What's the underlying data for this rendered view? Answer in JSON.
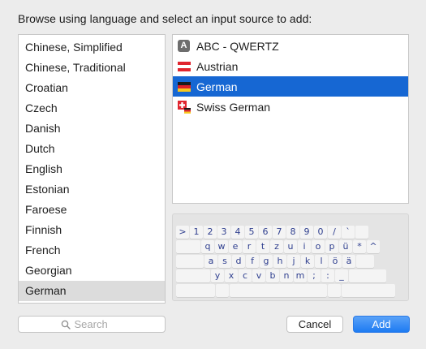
{
  "header": {
    "title": "Browse using language and select an input source to add:"
  },
  "languages": [
    {
      "label": "Chinese, Simplified",
      "selected": false
    },
    {
      "label": "Chinese, Traditional",
      "selected": false
    },
    {
      "label": "Croatian",
      "selected": false
    },
    {
      "label": "Czech",
      "selected": false
    },
    {
      "label": "Danish",
      "selected": false
    },
    {
      "label": "Dutch",
      "selected": false
    },
    {
      "label": "English",
      "selected": false
    },
    {
      "label": "Estonian",
      "selected": false
    },
    {
      "label": "Faroese",
      "selected": false
    },
    {
      "label": "Finnish",
      "selected": false
    },
    {
      "label": "French",
      "selected": false
    },
    {
      "label": "Georgian",
      "selected": false
    },
    {
      "label": "German",
      "selected": true
    }
  ],
  "sources": [
    {
      "label": "ABC - QWERTZ",
      "icon": "abc-icon",
      "icon_text": "A",
      "selected": false
    },
    {
      "label": "Austrian",
      "icon": "austria-flag-icon",
      "selected": false
    },
    {
      "label": "German",
      "icon": "germany-flag-icon",
      "selected": true
    },
    {
      "label": "Swiss German",
      "icon": "switzerland-flag-icon",
      "selected": false
    }
  ],
  "keyboard": {
    "rows": [
      [
        ">",
        "1",
        "2",
        "3",
        "4",
        "5",
        "6",
        "7",
        "8",
        "9",
        "0",
        "/",
        "`",
        ""
      ],
      [
        "",
        "q",
        "w",
        "e",
        "r",
        "t",
        "z",
        "u",
        "i",
        "o",
        "p",
        "ü",
        "*",
        "^"
      ],
      [
        "",
        "a",
        "s",
        "d",
        "f",
        "g",
        "h",
        "j",
        "k",
        "l",
        "ö",
        "ä",
        ""
      ],
      [
        "",
        "y",
        "x",
        "c",
        "v",
        "b",
        "n",
        "m",
        ";",
        ":",
        "_",
        ""
      ],
      [
        "",
        "",
        "",
        "",
        ""
      ]
    ]
  },
  "search": {
    "placeholder": "Search"
  },
  "buttons": {
    "cancel": "Cancel",
    "add": "Add"
  },
  "colors": {
    "selection_blue": "#1667d3",
    "selection_gray": "#dcdcdc",
    "key_text": "#2f3f8f"
  }
}
